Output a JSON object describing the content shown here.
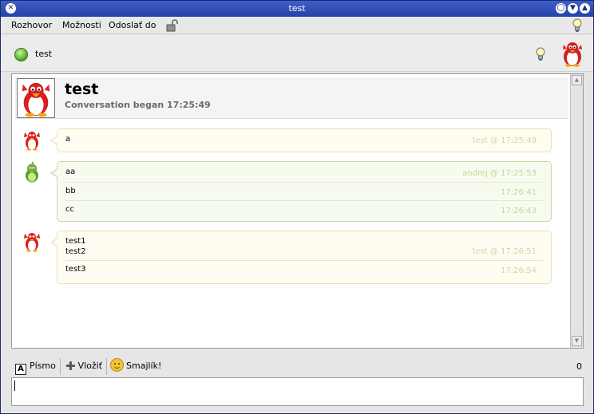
{
  "window": {
    "title": "test"
  },
  "menubar": {
    "items": [
      {
        "label": "Rozhovor"
      },
      {
        "label": "Možnosti"
      },
      {
        "label": "Odoslať do"
      }
    ]
  },
  "contact": {
    "name": "test",
    "status": "online"
  },
  "conversation": {
    "title": "test",
    "began": "Conversation began 17:25:49"
  },
  "messages": [
    {
      "sender": "test",
      "lines": [
        {
          "text": "a",
          "time": "test @ 17:25:49"
        }
      ]
    },
    {
      "sender": "andrej",
      "lines": [
        {
          "text": "aa",
          "time": "andrej @ 17:25:53"
        },
        {
          "text": "bb",
          "time": "17:26:41"
        },
        {
          "text": "cc",
          "time": "17:26:43"
        }
      ]
    },
    {
      "sender": "test",
      "lines": [
        {
          "text": "test1\ntest2",
          "time": "test @ 17:26:51"
        },
        {
          "text": "test3",
          "time": "17:26:54"
        }
      ]
    }
  ],
  "toolbar": {
    "font_label": "Písmo",
    "insert_label": "Vložiť",
    "smiley_label": "Smajlík!",
    "char_count": "0"
  },
  "colors": {
    "titlebar": "#2f4fb8",
    "own_bubble": "#fffdf1",
    "other_bubble": "#f7fbef",
    "status_online": "#5fb42c"
  }
}
